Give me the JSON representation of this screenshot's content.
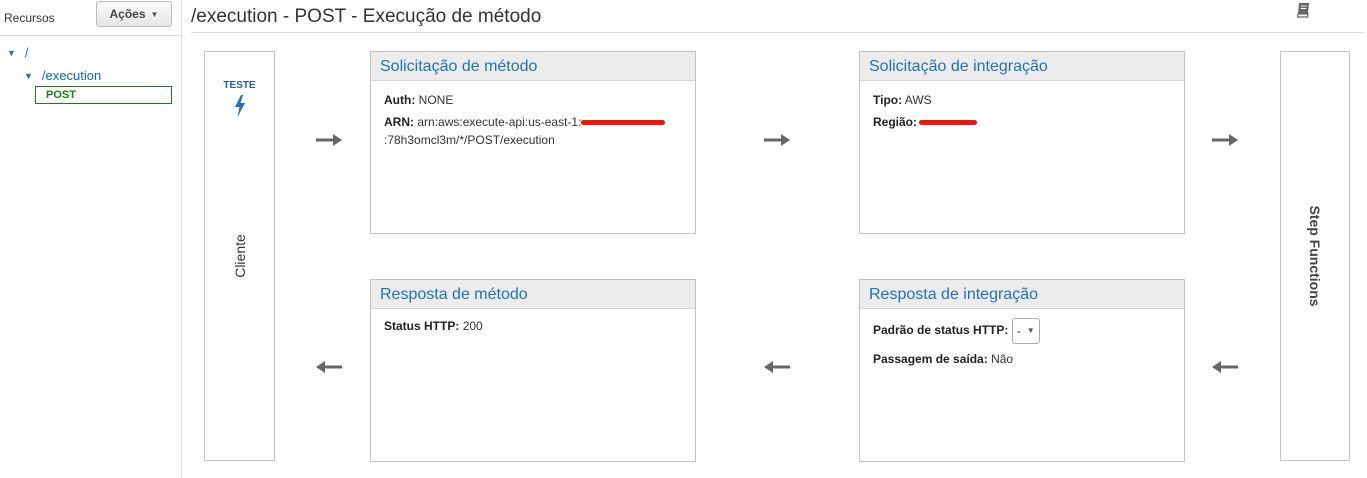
{
  "sidebar": {
    "title": "Recursos",
    "actions_label": "Ações",
    "tree": {
      "root_label": "/",
      "child_label": "/execution",
      "method_label": "POST"
    }
  },
  "page": {
    "title": "/execution - POST - Execução de método"
  },
  "client": {
    "test_label": "TESTE",
    "label": "Cliente"
  },
  "backend": {
    "label": "Step Functions"
  },
  "method_request": {
    "title": "Solicitação de método",
    "auth_label": "Auth:",
    "auth_value": "NONE",
    "arn_label": "ARN:",
    "arn_prefix": "arn:aws:execute-api:us-east-1:",
    "arn_suffix": ":78h3omcl3m/*/POST/execution"
  },
  "integration_request": {
    "title": "Solicitação de integração",
    "type_label": "Tipo:",
    "type_value": "AWS",
    "region_label": "Região:"
  },
  "method_response": {
    "title": "Resposta de método",
    "status_label": "Status HTTP:",
    "status_value": "200"
  },
  "integration_response": {
    "title": "Resposta de integração",
    "pattern_label": "Padrão de status HTTP:",
    "pattern_value": "-",
    "passthrough_label": "Passagem de saída:",
    "passthrough_value": "Não"
  },
  "icons": {
    "book": "book-icon",
    "bolt": "lightning-bolt-icon",
    "arrow_right": "arrow-right-icon",
    "arrow_left": "arrow-left-icon"
  },
  "colors": {
    "link_blue": "#1f72bf",
    "post_green": "#1a7d1a",
    "redaction_red": "#e8160c",
    "panel_header_bg": "#ececec"
  }
}
